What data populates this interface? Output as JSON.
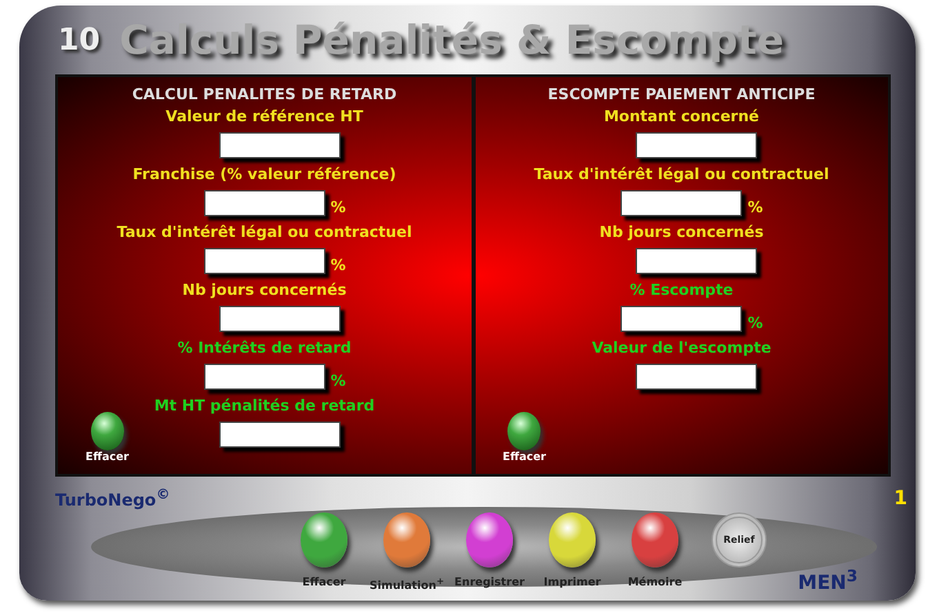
{
  "title": {
    "number": "10",
    "text": "Calculs Pénalités & Escompte"
  },
  "panels": [
    {
      "heading": "CALCUL PENALITES DE RETARD",
      "clear_label": "Effacer",
      "fields": [
        {
          "label": "Valeur de référence HT",
          "kind": "input"
        },
        {
          "label": "Franchise (% valeur référence)",
          "kind": "input",
          "suffix": "%"
        },
        {
          "label": "Taux d'intérêt légal ou contractuel",
          "kind": "input",
          "suffix": "%"
        },
        {
          "label": "Nb jours concernés",
          "kind": "input"
        },
        {
          "label": "% Intérêts de retard",
          "kind": "result",
          "suffix": "%"
        },
        {
          "label": "Mt HT pénalités de retard",
          "kind": "result"
        }
      ]
    },
    {
      "heading": "ESCOMPTE PAIEMENT ANTICIPE",
      "clear_label": "Effacer",
      "fields": [
        {
          "label": "Montant concerné",
          "kind": "input"
        },
        {
          "label": "Taux d'intérêt légal ou contractuel",
          "kind": "input",
          "suffix": "%"
        },
        {
          "label": "Nb jours concernés",
          "kind": "input"
        },
        {
          "label": "% Escompte",
          "kind": "result",
          "suffix": "%"
        },
        {
          "label": "Valeur de l'escompte",
          "kind": "result"
        }
      ]
    }
  ],
  "brand": "TurboNego$^{©}$",
  "page_number": "1",
  "buttons": [
    {
      "label": "Effacer",
      "color": "#3fa83f"
    },
    {
      "label": "Simulation$^{+}$",
      "color": "#e07a3a"
    },
    {
      "label": "Enregistrer",
      "color": "#d23fd2"
    },
    {
      "label": "Imprimer",
      "color": "#d8d83a"
    },
    {
      "label": "Mémoire",
      "color": "#d84040"
    }
  ],
  "relief_label": "Relief",
  "footer_mark": "MEN$^{3}$"
}
